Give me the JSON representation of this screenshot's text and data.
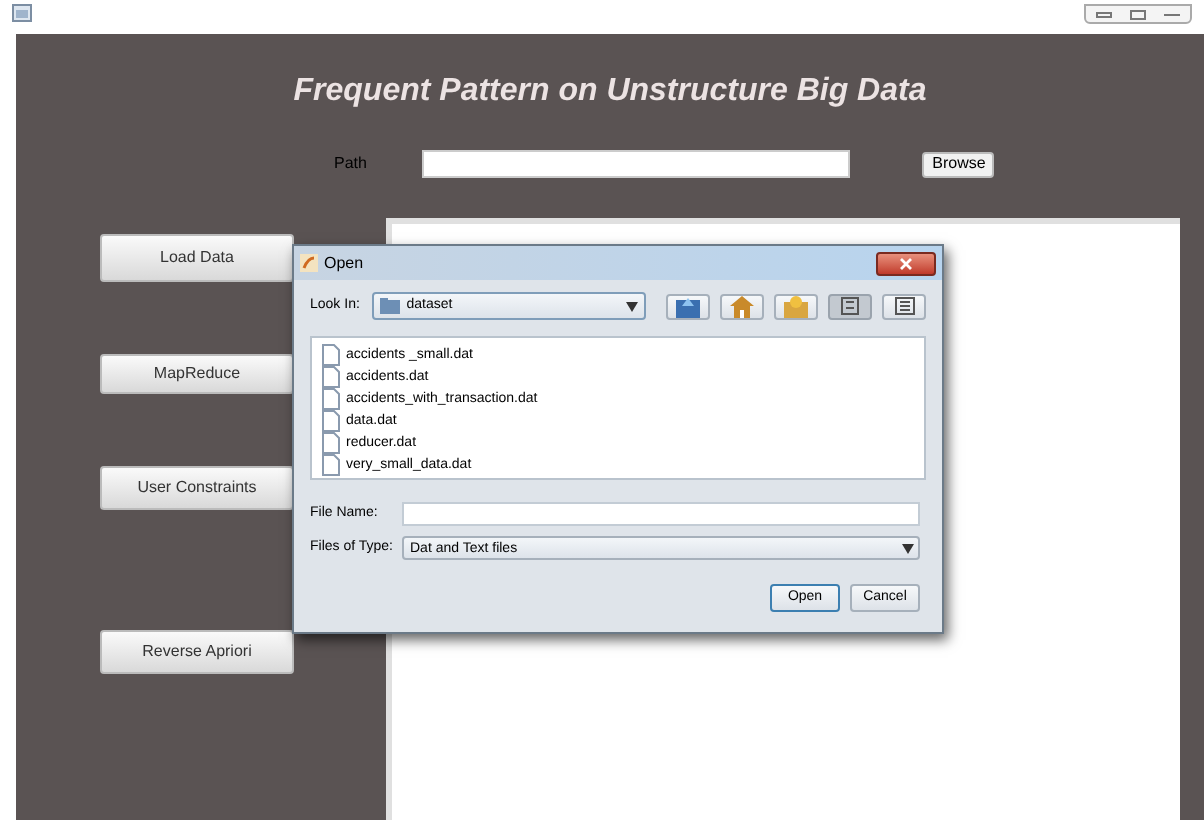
{
  "title": "Frequent Pattern on Unstructure Big Data",
  "path": {
    "label": "Path",
    "browse": "Browse"
  },
  "side_buttons": [
    "Load Data",
    "MapReduce",
    "User Constraints",
    "Reverse Apriori"
  ],
  "dialog": {
    "title": "Open",
    "look_in_label": "Look In:",
    "look_in_value": "dataset",
    "toolbar": [
      {
        "kind": "up",
        "selected": false
      },
      {
        "kind": "home",
        "selected": false
      },
      {
        "kind": "newfolder",
        "selected": false
      },
      {
        "kind": "list",
        "selected": true
      },
      {
        "kind": "details",
        "selected": false
      }
    ],
    "files": [
      "accidents _small.dat",
      "accidents.dat",
      "accidents_with_transaction.dat",
      "data.dat",
      "reducer.dat",
      "very_small_data.dat"
    ],
    "file_name_label": "File Name:",
    "files_of_type_label": "Files of Type:",
    "files_of_type_value": "Dat and Text files",
    "buttons": [
      "Open",
      "Cancel"
    ]
  }
}
